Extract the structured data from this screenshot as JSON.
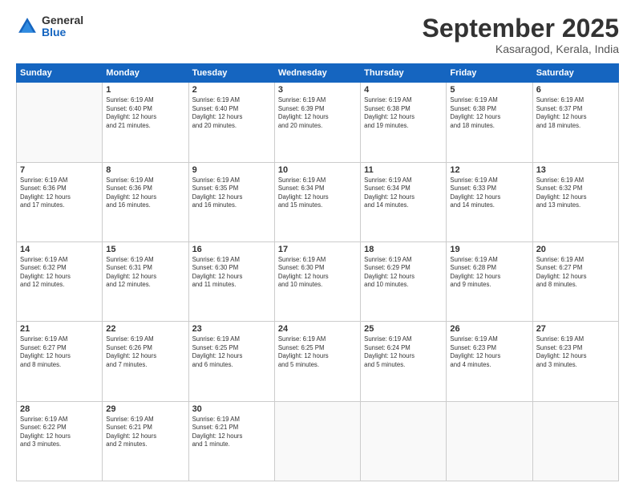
{
  "logo": {
    "general": "General",
    "blue": "Blue"
  },
  "header": {
    "month": "September 2025",
    "location": "Kasaragod, Kerala, India"
  },
  "weekdays": [
    "Sunday",
    "Monday",
    "Tuesday",
    "Wednesday",
    "Thursday",
    "Friday",
    "Saturday"
  ],
  "weeks": [
    [
      {
        "day": "",
        "info": ""
      },
      {
        "day": "1",
        "info": "Sunrise: 6:19 AM\nSunset: 6:40 PM\nDaylight: 12 hours\nand 21 minutes."
      },
      {
        "day": "2",
        "info": "Sunrise: 6:19 AM\nSunset: 6:40 PM\nDaylight: 12 hours\nand 20 minutes."
      },
      {
        "day": "3",
        "info": "Sunrise: 6:19 AM\nSunset: 6:39 PM\nDaylight: 12 hours\nand 20 minutes."
      },
      {
        "day": "4",
        "info": "Sunrise: 6:19 AM\nSunset: 6:38 PM\nDaylight: 12 hours\nand 19 minutes."
      },
      {
        "day": "5",
        "info": "Sunrise: 6:19 AM\nSunset: 6:38 PM\nDaylight: 12 hours\nand 18 minutes."
      },
      {
        "day": "6",
        "info": "Sunrise: 6:19 AM\nSunset: 6:37 PM\nDaylight: 12 hours\nand 18 minutes."
      }
    ],
    [
      {
        "day": "7",
        "info": "Sunrise: 6:19 AM\nSunset: 6:36 PM\nDaylight: 12 hours\nand 17 minutes."
      },
      {
        "day": "8",
        "info": "Sunrise: 6:19 AM\nSunset: 6:36 PM\nDaylight: 12 hours\nand 16 minutes."
      },
      {
        "day": "9",
        "info": "Sunrise: 6:19 AM\nSunset: 6:35 PM\nDaylight: 12 hours\nand 16 minutes."
      },
      {
        "day": "10",
        "info": "Sunrise: 6:19 AM\nSunset: 6:34 PM\nDaylight: 12 hours\nand 15 minutes."
      },
      {
        "day": "11",
        "info": "Sunrise: 6:19 AM\nSunset: 6:34 PM\nDaylight: 12 hours\nand 14 minutes."
      },
      {
        "day": "12",
        "info": "Sunrise: 6:19 AM\nSunset: 6:33 PM\nDaylight: 12 hours\nand 14 minutes."
      },
      {
        "day": "13",
        "info": "Sunrise: 6:19 AM\nSunset: 6:32 PM\nDaylight: 12 hours\nand 13 minutes."
      }
    ],
    [
      {
        "day": "14",
        "info": "Sunrise: 6:19 AM\nSunset: 6:32 PM\nDaylight: 12 hours\nand 12 minutes."
      },
      {
        "day": "15",
        "info": "Sunrise: 6:19 AM\nSunset: 6:31 PM\nDaylight: 12 hours\nand 12 minutes."
      },
      {
        "day": "16",
        "info": "Sunrise: 6:19 AM\nSunset: 6:30 PM\nDaylight: 12 hours\nand 11 minutes."
      },
      {
        "day": "17",
        "info": "Sunrise: 6:19 AM\nSunset: 6:30 PM\nDaylight: 12 hours\nand 10 minutes."
      },
      {
        "day": "18",
        "info": "Sunrise: 6:19 AM\nSunset: 6:29 PM\nDaylight: 12 hours\nand 10 minutes."
      },
      {
        "day": "19",
        "info": "Sunrise: 6:19 AM\nSunset: 6:28 PM\nDaylight: 12 hours\nand 9 minutes."
      },
      {
        "day": "20",
        "info": "Sunrise: 6:19 AM\nSunset: 6:27 PM\nDaylight: 12 hours\nand 8 minutes."
      }
    ],
    [
      {
        "day": "21",
        "info": "Sunrise: 6:19 AM\nSunset: 6:27 PM\nDaylight: 12 hours\nand 8 minutes."
      },
      {
        "day": "22",
        "info": "Sunrise: 6:19 AM\nSunset: 6:26 PM\nDaylight: 12 hours\nand 7 minutes."
      },
      {
        "day": "23",
        "info": "Sunrise: 6:19 AM\nSunset: 6:25 PM\nDaylight: 12 hours\nand 6 minutes."
      },
      {
        "day": "24",
        "info": "Sunrise: 6:19 AM\nSunset: 6:25 PM\nDaylight: 12 hours\nand 5 minutes."
      },
      {
        "day": "25",
        "info": "Sunrise: 6:19 AM\nSunset: 6:24 PM\nDaylight: 12 hours\nand 5 minutes."
      },
      {
        "day": "26",
        "info": "Sunrise: 6:19 AM\nSunset: 6:23 PM\nDaylight: 12 hours\nand 4 minutes."
      },
      {
        "day": "27",
        "info": "Sunrise: 6:19 AM\nSunset: 6:23 PM\nDaylight: 12 hours\nand 3 minutes."
      }
    ],
    [
      {
        "day": "28",
        "info": "Sunrise: 6:19 AM\nSunset: 6:22 PM\nDaylight: 12 hours\nand 3 minutes."
      },
      {
        "day": "29",
        "info": "Sunrise: 6:19 AM\nSunset: 6:21 PM\nDaylight: 12 hours\nand 2 minutes."
      },
      {
        "day": "30",
        "info": "Sunrise: 6:19 AM\nSunset: 6:21 PM\nDaylight: 12 hours\nand 1 minute."
      },
      {
        "day": "",
        "info": ""
      },
      {
        "day": "",
        "info": ""
      },
      {
        "day": "",
        "info": ""
      },
      {
        "day": "",
        "info": ""
      }
    ]
  ]
}
